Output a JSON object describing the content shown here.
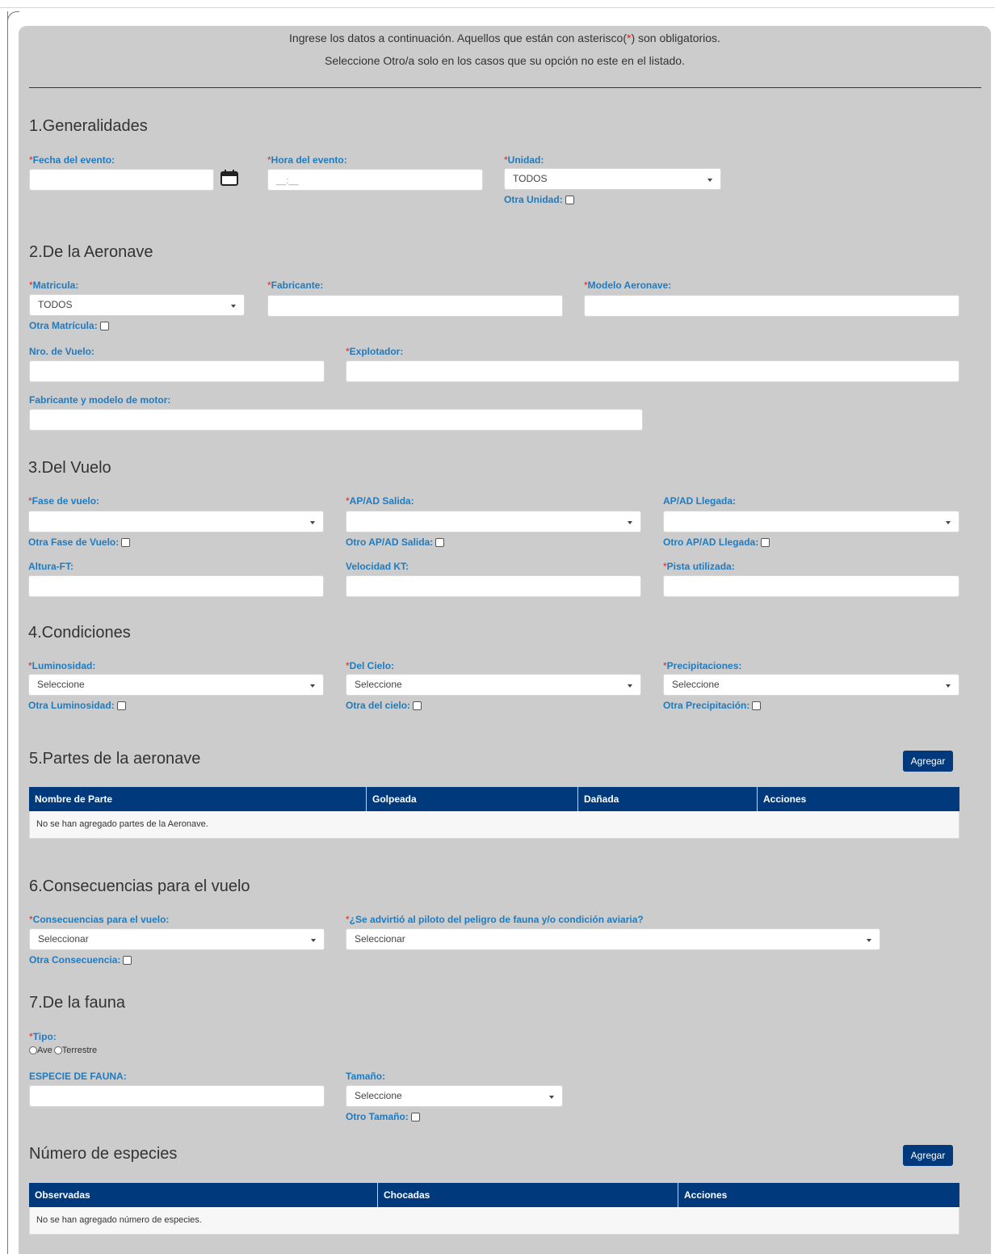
{
  "intro": {
    "line1_before": "Ingrese los datos a continuación. Aquellos que están con asterisco(",
    "line1_star": "*",
    "line1_after": ") son obligatorios.",
    "line2": "Seleccione Otro/a solo en los casos que su opción no este en el listado."
  },
  "req_mark": "*",
  "s1": {
    "title": "1.Generalidades",
    "fecha_label": "Fecha del evento:",
    "hora_label": "Hora del evento:",
    "hora_placeholder": "__:__",
    "unidad_label": "Unidad:",
    "unidad_value": "TODOS",
    "otra_unidad": "Otra Unidad:"
  },
  "s2": {
    "title": "2.De la Aeronave",
    "matricula_label": "Matricula:",
    "matricula_value": "TODOS",
    "otra_matricula": "Otra Matrícula:",
    "fabricante_label": "Fabricante:",
    "modelo_label": "Modelo Aeronave:",
    "nro_vuelo_label": "Nro. de Vuelo:",
    "explotador_label": "Explotador:",
    "motor_label": "Fabricante y modelo de motor:"
  },
  "s3": {
    "title": "3.Del Vuelo",
    "fase_label": "Fase de vuelo:",
    "otra_fase": "Otra Fase de Vuelo:",
    "salida_label": "AP/AD Salida:",
    "otro_salida": "Otro AP/AD Salida:",
    "llegada_label": "AP/AD Llegada:",
    "otro_llegada": "Otro AP/AD Llegada:",
    "altura_label": "Altura-FT:",
    "velocidad_label": "Velocidad KT:",
    "pista_label": "Pista utilizada:"
  },
  "s4": {
    "title": "4.Condiciones",
    "luminosidad_label": "Luminosidad:",
    "luminosidad_value": "Seleccione",
    "otra_luminosidad": "Otra Luminosidad:",
    "cielo_label": "Del Cielo:",
    "cielo_value": "Seleccione",
    "otra_cielo": "Otra del cielo:",
    "precip_label": "Precipitaciones:",
    "precip_value": "Seleccione",
    "otra_precip": "Otra Precipitación:"
  },
  "s5": {
    "title": "5.Partes de la aeronave",
    "add_button": "Agregar",
    "columns": [
      "Nombre de Parte",
      "Golpeada",
      "Dañada",
      "Acciones"
    ],
    "empty": "No se han agregado partes de la Aeronave."
  },
  "s6": {
    "title": "6.Consecuencias para el vuelo",
    "consec_label": "Consecuencias para el vuelo:",
    "consec_value": "Seleccionar",
    "otra_consec": "Otra Consecuencia:",
    "advirtio_label": "¿Se advirtió al piloto del peligro de fauna y/o condición aviaria?",
    "advirtio_value": "Seleccionar"
  },
  "s7": {
    "title": "7.De la fauna",
    "tipo_label": "Tipo:",
    "tipo_options": [
      "Ave",
      "Terrestre"
    ],
    "especie_label": "ESPECIE DE FAUNA:",
    "tamano_label": "Tamaño:",
    "tamano_value": "Seleccione",
    "otro_tamano": "Otro Tamaño:"
  },
  "s8": {
    "title": "Número de especies",
    "add_button": "Agregar",
    "columns": [
      "Observadas",
      "Chocadas",
      "Acciones"
    ],
    "empty": "No se han agregado número de especies."
  },
  "colors": {
    "panel_bg": "#cccccc",
    "label_blue": "#1f7bc0",
    "required_red": "#e02020",
    "primary_navy": "#003a7d"
  }
}
